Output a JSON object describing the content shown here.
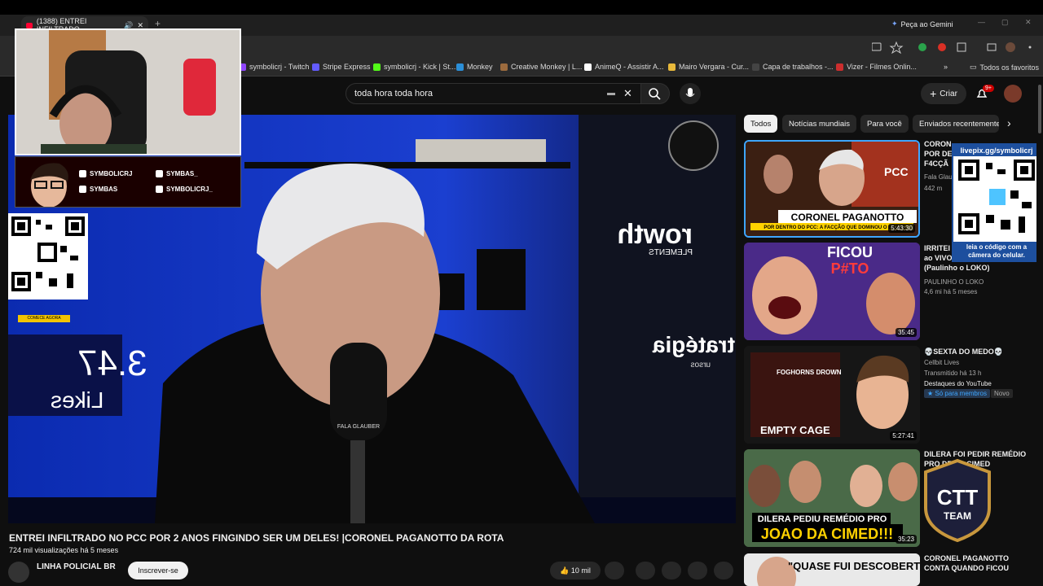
{
  "browser": {
    "tab_title": "(1388) ENTREI INFILTRADO",
    "gemini_label": "Peça ao Gemini",
    "bookmarks": [
      "symbolicrj - Twitch",
      "Stripe Express",
      "symbolicrj - Kick | St...",
      "Monkey",
      "Creative Monkey | L...",
      "AnimeQ - Assistir A...",
      "Mairo Vergara - Cur...",
      "Capa de trabalhos -...",
      "Vizer - Filmes Onlin..."
    ],
    "all_bookmarks": "Todos os favoritos",
    "bookmark_colors": [
      "#9146ff",
      "#635bff",
      "#53fc18",
      "#2b8fd8",
      "#9c6b3e",
      "#ffffff",
      "#e8b93b",
      "#444444",
      "#cc2e2e"
    ]
  },
  "header": {
    "search_value": "toda hora toda hora",
    "create_label": "Criar",
    "notif_badge": "9+"
  },
  "video": {
    "title": "ENTREI INFILTRADO NO PCC POR 2 ANOS FINGINDO SER UM DELES! |CORONEL PAGANOTTO DA ROTA",
    "meta": "724 mil visualizações  há 5 meses",
    "channel": "LINHA POLICIAL BR",
    "subscribe": "Inscrever-se",
    "likes": "10 mil",
    "bg_sign_left": "3.47",
    "bg_sign_likes": "Likes",
    "bg_sign_growth": "rowth",
    "bg_sign_growth2": "PLEMENTS",
    "bg_sign_estrategia": "tratégia",
    "bg_sign_cursos": "ursos",
    "mic_label": "FALA GLAUBER"
  },
  "overlay": {
    "socials": [
      "SYMBOLICRJ",
      "SYMBAS_",
      "SYMBAS",
      "SYMBOLICRJ_"
    ],
    "qr_left_caption": "COMECE AGORA",
    "qr_right_url": "livepix.gg/symbolicrj",
    "qr_right_caption": "leia o código com a câmera do celular.",
    "logo_text": "CTT",
    "logo_sub": "TEAM"
  },
  "chips": [
    "Todos",
    "Notícias mundiais",
    "Para você",
    "Enviados recentemente"
  ],
  "related": [
    {
      "title": "CORONEL PAGANOTTO POR DENTRO DO PCC: A F4CÇÃO QUE DOMINOU O",
      "title_visible": [
        "CORON",
        "POR DE",
        "F4CÇÃ"
      ],
      "channel": "Fala Glau",
      "stats": "442 m",
      "duration": "5:43:30",
      "thumb_text": "CORONEL PAGANOTTO",
      "thumb_sub": "POR DENTRO DO PCC: A FACÇÃO QUE DOMINOU O BRASIL",
      "thumb_tag": "PCC"
    },
    {
      "title_lines": [
        "IRRITEI",
        "ao VIVO",
        "(Paulinho o LOKO)"
      ],
      "channel": "PAULINHO O LOKO",
      "stats": "4,6 mi  há 5 meses",
      "duration": "35:45",
      "thumb_text": "FICOU",
      "thumb_text2": "P#TO"
    },
    {
      "title": "💀SEXTA DO MEDO💀",
      "channel": "Cellbit Lives",
      "stats": "Transmitido há 13 h",
      "extra": "Destaques do YouTube",
      "members": "Só para membros",
      "new_label": "Novo",
      "duration": "5:27:41",
      "thumb_text": "EMPTY CAGE",
      "thumb_text2": "FOGHORNS DROWN"
    },
    {
      "title_lines": [
        "DILERA FOI PEDIR REMÉDIO",
        "PRO    DE DA CIMED"
      ],
      "duration": "35:23",
      "thumb_text": "DILERA PEDIU REMÉDIO PRO",
      "thumb_text2": "JOAO DA CIMED!!!"
    },
    {
      "title_lines": [
        "CORONEL PAGANOTTO",
        "CONTA QUANDO FICOU"
      ],
      "thumb_text": "\"QUASE FUI DESCOBERTO"
    }
  ]
}
